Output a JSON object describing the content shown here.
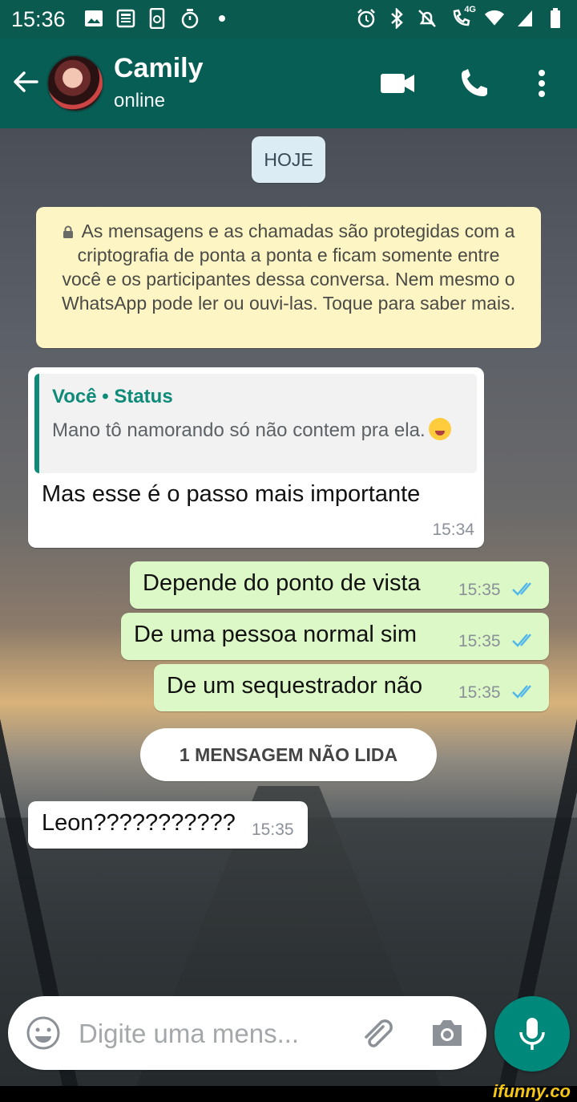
{
  "status_bar": {
    "time": "15:36",
    "left_icons": [
      "image-icon",
      "news-icon",
      "sync-icon",
      "timer-icon",
      "dot-icon"
    ],
    "right_icons": [
      "alarm-icon",
      "bluetooth-icon",
      "mute-icon",
      "call-4g-icon",
      "wifi-icon",
      "signal-icon",
      "battery-icon"
    ],
    "network_label": "4G"
  },
  "header": {
    "contact_name": "Camily",
    "presence": "online",
    "background_color": "#075e54"
  },
  "chat": {
    "date_chip": "HOJE",
    "encryption_note": "As mensagens e as chamadas são protegidas com a criptografia de ponta a ponta e ficam somente entre você e os participantes dessa conversa. Nem mesmo o WhatsApp pode ler ou ouvi-las. Toque para saber mais.",
    "reply_message": {
      "quote_author": "Você • Status",
      "quote_text": "Mano tô namorando só não contem pra ela.",
      "text": "Mas esse é o passo mais importante",
      "time": "15:34"
    },
    "outgoing_messages": [
      {
        "text": "Depende do ponto de vista",
        "time": "15:35",
        "status": "read"
      },
      {
        "text": "De uma pessoa normal sim",
        "time": "15:35",
        "status": "read"
      },
      {
        "text": "De um sequestrador não",
        "time": "15:35",
        "status": "read"
      }
    ],
    "unread_divider": "1 MENSAGEM NÃO LIDA",
    "incoming_messages": [
      {
        "text": "Leon???????????",
        "time": "15:35"
      }
    ]
  },
  "composer": {
    "placeholder": "Digite uma mens..."
  },
  "colors": {
    "outgoing_bubble": "#dcf8c6",
    "incoming_bubble": "#ffffff",
    "read_ticks": "#4fb6ec",
    "accent": "#00897b"
  },
  "watermark": "ifunny.co"
}
